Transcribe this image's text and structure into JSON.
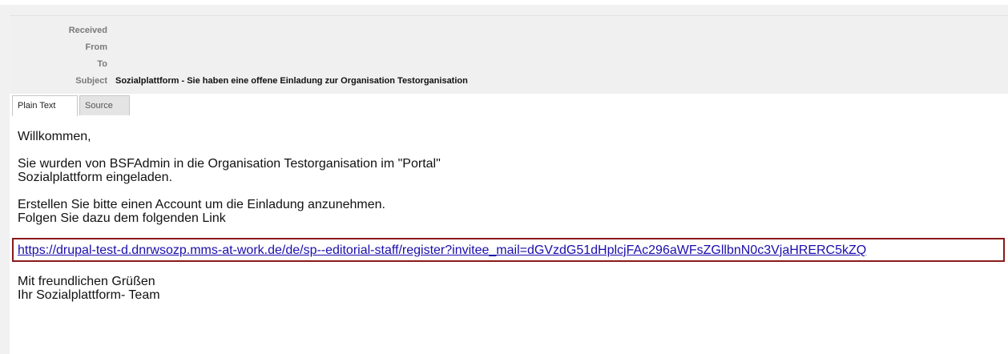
{
  "email": {
    "headers": {
      "received_label": "Received",
      "from_label": "From",
      "to_label": "To",
      "subject_label": "Subject",
      "subject_value": "Sozialplattform - Sie haben eine offene Einladung zur Organisation Testorganisation"
    },
    "tabs": [
      {
        "label": "Plain Text",
        "active": true
      },
      {
        "label": "Source",
        "active": false
      }
    ],
    "body": {
      "greeting": "Willkommen,",
      "invite_line1": "Sie wurden von BSFAdmin in die Organisation Testorganisation im \"Portal\"",
      "invite_line2": "Sozialplattform eingeladen.",
      "instruction_line1": "Erstellen Sie bitte einen Account um die Einladung anzunehmen.",
      "instruction_line2": "Folgen Sie dazu dem folgenden Link",
      "link": "https://drupal-test-d.dnrwsozp.mms-at-work.de/de/sp--editorial-staff/register?invitee_mail=dGVzdG51dHplcjFAc296aWFsZGllbnN0c3VjaHRERC5kZQ",
      "closing_line1": "Mit freundlichen Grüßen",
      "closing_line2": "Ihr Sozialplattform- Team"
    },
    "highlight_color": "#8b1a1a",
    "link_color": "#1a0dab"
  }
}
